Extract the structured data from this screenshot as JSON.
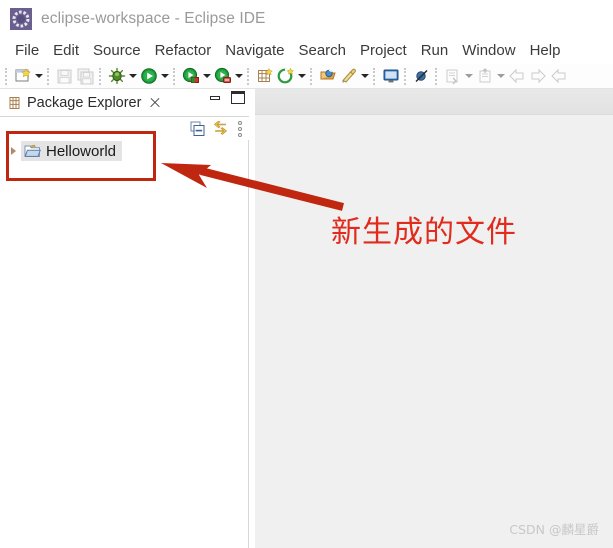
{
  "window": {
    "title": "eclipse-workspace - Eclipse IDE",
    "logo_icon": "eclipse-logo-icon"
  },
  "menubar": {
    "items": [
      {
        "label": "File"
      },
      {
        "label": "Edit"
      },
      {
        "label": "Source"
      },
      {
        "label": "Refactor"
      },
      {
        "label": "Navigate"
      },
      {
        "label": "Search"
      },
      {
        "label": "Project"
      },
      {
        "label": "Run"
      },
      {
        "label": "Window"
      },
      {
        "label": "Help"
      }
    ]
  },
  "toolbar": {
    "buttons": [
      {
        "name": "new-wizard-icon",
        "enabled": true
      },
      {
        "name": "save-icon",
        "enabled": false
      },
      {
        "name": "save-all-icon",
        "enabled": false
      },
      {
        "name": "debug-icon",
        "enabled": true
      },
      {
        "name": "run-icon",
        "enabled": true
      },
      {
        "name": "coverage-icon",
        "enabled": true
      },
      {
        "name": "profile-icon",
        "enabled": true
      },
      {
        "name": "new-java-project-icon",
        "enabled": true
      },
      {
        "name": "new-java-class-icon",
        "enabled": true
      },
      {
        "name": "open-type-icon",
        "enabled": true
      },
      {
        "name": "new-package-icon",
        "enabled": true
      },
      {
        "name": "display-view-icon",
        "enabled": true
      },
      {
        "name": "skip-breakpoints-icon",
        "enabled": true
      },
      {
        "name": "next-annotation-icon",
        "enabled": false
      },
      {
        "name": "previous-edit-icon",
        "enabled": false
      },
      {
        "name": "back-icon",
        "enabled": false
      },
      {
        "name": "forward-icon",
        "enabled": false
      },
      {
        "name": "last-edit-icon",
        "enabled": false
      }
    ]
  },
  "package_explorer": {
    "tab_label": "Package Explorer",
    "tab_icon": "package-explorer-icon",
    "close_icon": "close-icon",
    "minimize_icon": "minimize-icon",
    "maximize_icon": "maximize-icon",
    "view_toolbar": [
      {
        "name": "collapse-all-icon"
      },
      {
        "name": "link-with-editor-icon"
      },
      {
        "name": "view-menu-icon"
      }
    ],
    "tree": [
      {
        "label": "Helloworld",
        "icon": "java-project-folder-icon",
        "selected": true,
        "expanded": false
      }
    ]
  },
  "editor": {
    "open_tabs": []
  },
  "annotations": {
    "highlight_box_color": "#bf2711",
    "arrow_color": "#bf2711",
    "callout_text": "新生成的文件",
    "callout_color": "#e12b1c"
  },
  "watermark": {
    "text": "CSDN @麟星爵"
  }
}
